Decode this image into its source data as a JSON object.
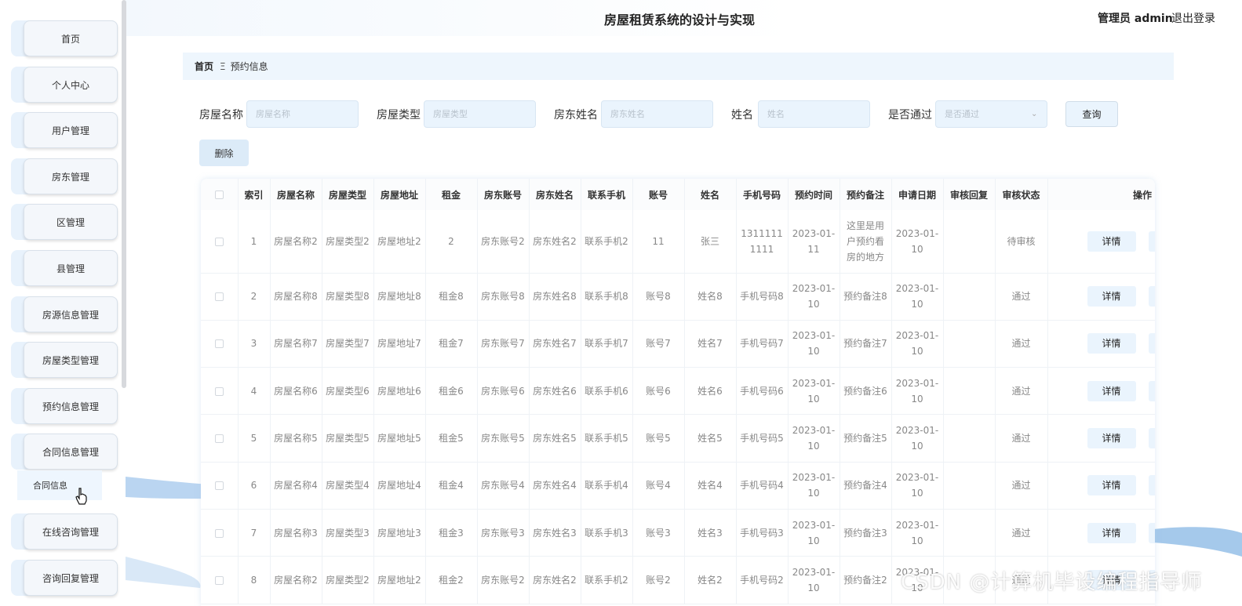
{
  "header": {
    "title": "房屋租赁系统的设计与实现",
    "admin_label": "管理员 admin",
    "logout_label": "退出登录"
  },
  "sidebar": {
    "items": [
      {
        "label": "首页"
      },
      {
        "label": "个人中心"
      },
      {
        "label": "用户管理"
      },
      {
        "label": "房东管理"
      },
      {
        "label": "区管理"
      },
      {
        "label": "县管理"
      },
      {
        "label": "房源信息管理"
      },
      {
        "label": "房屋类型管理"
      },
      {
        "label": "预约信息管理"
      },
      {
        "label": "合同信息管理"
      },
      {
        "label": "在线咨询管理"
      },
      {
        "label": "咨询回复管理"
      }
    ],
    "submenu_label": "合同信息"
  },
  "breadcrumb": {
    "home": "首页",
    "separator": "Ξ",
    "current": "预约信息"
  },
  "search": {
    "house_name_label": "房屋名称",
    "house_name_placeholder": "房屋名称",
    "house_type_label": "房屋类型",
    "house_type_placeholder": "房屋类型",
    "landlord_name_label": "房东姓名",
    "landlord_name_placeholder": "房东姓名",
    "name_label": "姓名",
    "name_placeholder": "姓名",
    "approved_label": "是否通过",
    "approved_placeholder": "是否通过",
    "query_label": "查询"
  },
  "actions": {
    "delete_label": "删除",
    "detail_label": "详情"
  },
  "table": {
    "headers": [
      "索引",
      "房屋名称",
      "房屋类型",
      "房屋地址",
      "租金",
      "房东账号",
      "房东姓名",
      "联系手机",
      "账号",
      "姓名",
      "手机号码",
      "预约时间",
      "预约备注",
      "申请日期",
      "审核回复",
      "审核状态",
      "操作"
    ],
    "rows": [
      [
        "1",
        "房屋名称2",
        "房屋类型2",
        "房屋地址2",
        "2",
        "房东账号2",
        "房东姓名2",
        "联系手机2",
        "11",
        "张三",
        "13111111111",
        "2023-01-11",
        "这里是用户预约看房的地方",
        "2023-01-10",
        "",
        "待审核"
      ],
      [
        "2",
        "房屋名称8",
        "房屋类型8",
        "房屋地址8",
        "租金8",
        "房东账号8",
        "房东姓名8",
        "联系手机8",
        "账号8",
        "姓名8",
        "手机号码8",
        "2023-01-10",
        "预约备注8",
        "2023-01-10",
        "",
        "通过"
      ],
      [
        "3",
        "房屋名称7",
        "房屋类型7",
        "房屋地址7",
        "租金7",
        "房东账号7",
        "房东姓名7",
        "联系手机7",
        "账号7",
        "姓名7",
        "手机号码7",
        "2023-01-10",
        "预约备注7",
        "2023-01-10",
        "",
        "通过"
      ],
      [
        "4",
        "房屋名称6",
        "房屋类型6",
        "房屋地址6",
        "租金6",
        "房东账号6",
        "房东姓名6",
        "联系手机6",
        "账号6",
        "姓名6",
        "手机号码6",
        "2023-01-10",
        "预约备注6",
        "2023-01-10",
        "",
        "通过"
      ],
      [
        "5",
        "房屋名称5",
        "房屋类型5",
        "房屋地址5",
        "租金5",
        "房东账号5",
        "房东姓名5",
        "联系手机5",
        "账号5",
        "姓名5",
        "手机号码5",
        "2023-01-10",
        "预约备注5",
        "2023-01-10",
        "",
        "通过"
      ],
      [
        "6",
        "房屋名称4",
        "房屋类型4",
        "房屋地址4",
        "租金4",
        "房东账号4",
        "房东姓名4",
        "联系手机4",
        "账号4",
        "姓名4",
        "手机号码4",
        "2023-01-10",
        "预约备注4",
        "2023-01-10",
        "",
        "通过"
      ],
      [
        "7",
        "房屋名称3",
        "房屋类型3",
        "房屋地址3",
        "租金3",
        "房东账号3",
        "房东姓名3",
        "联系手机3",
        "账号3",
        "姓名3",
        "手机号码3",
        "2023-01-10",
        "预约备注3",
        "2023-01-10",
        "",
        "通过"
      ],
      [
        "8",
        "房屋名称2",
        "房屋类型2",
        "房屋地址2",
        "租金2",
        "房东账号2",
        "房东姓名2",
        "联系手机2",
        "账号2",
        "姓名2",
        "手机号码2",
        "2023-01-10",
        "预约备注2",
        "2023-01-10",
        "",
        "通过"
      ]
    ]
  },
  "watermark": "CSDN @计算机毕设编程指导师"
}
